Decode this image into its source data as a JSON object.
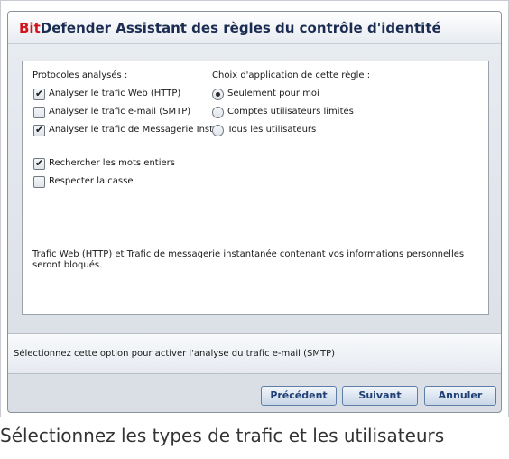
{
  "dialog": {
    "title_brand": "Bit",
    "title_rest": "Defender Assistant des règles du contrôle d'identité",
    "protocols_heading": "Protocoles analysés :",
    "apply_heading": "Choix d'application de cette règle :",
    "protocols": [
      {
        "label": "Analyser le trafic Web (HTTP)",
        "checked": true
      },
      {
        "label": "Analyser le trafic e-mail (SMTP)",
        "checked": false
      },
      {
        "label": "Analyser le trafic de Messagerie Inst.",
        "checked": true
      }
    ],
    "apply_options": [
      {
        "label": "Seulement pour moi",
        "selected": true
      },
      {
        "label": "Comptes utilisateurs limités",
        "selected": false
      },
      {
        "label": "Tous les utilisateurs",
        "selected": false
      }
    ],
    "match_options": [
      {
        "label": "Rechercher les mots entiers",
        "checked": true
      },
      {
        "label": "Respecter la casse",
        "checked": false
      }
    ],
    "info_text": "Trafic Web (HTTP) et Trafic de messagerie instantanée contenant vos informations personnelles seront bloqués.",
    "hint_text": "Sélectionnez cette option pour activer l'analyse du trafic e-mail (SMTP)",
    "buttons": {
      "previous": "Précédent",
      "next": "Suivant",
      "cancel": "Annuler"
    }
  },
  "caption": "Sélectionnez les types de trafic et les utilisateurs",
  "colors": {
    "brand_red": "#d2141d",
    "title_navy": "#1a2c52",
    "button_text": "#1f3f75"
  }
}
